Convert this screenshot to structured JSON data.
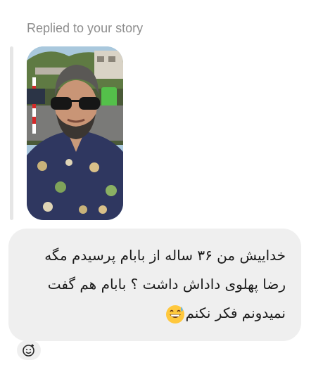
{
  "reply": {
    "header": "Replied to your story"
  },
  "story": {
    "thumbnail_icon": "story-photo-man-sunglasses"
  },
  "message": {
    "lines": [
      "خداییش من ۳۶ ساله از بابام پرسیدم مگه",
      "رضا پهلوی داداش داشت ؟  بابام هم گفت",
      "نمیدونم فکر نکنم"
    ],
    "emoji_icon": "grinning-sweat-emoji",
    "bubble_color": "#efefef"
  },
  "reaction": {
    "icon": "add-reaction-smiley-icon"
  }
}
